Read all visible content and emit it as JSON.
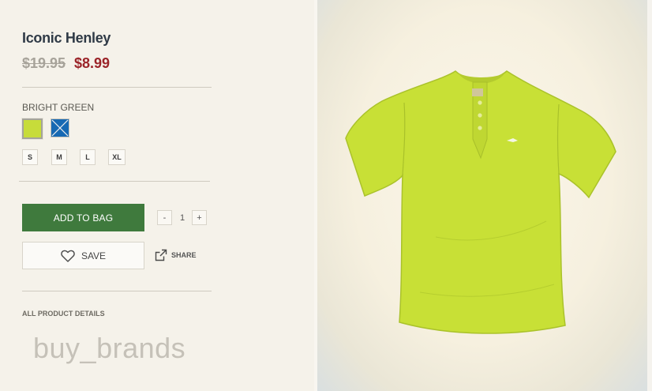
{
  "product": {
    "name": "Iconic Henley",
    "old_price": "$19.95",
    "price": "$8.99"
  },
  "color": {
    "selected_label": "BRIGHT GREEN",
    "swatches": [
      {
        "name": "bright green",
        "hex": "#c7dc3a"
      },
      {
        "name": "blue",
        "hex": "#1769b3"
      }
    ]
  },
  "sizes": [
    "S",
    "M",
    "L",
    "XL"
  ],
  "actions": {
    "add_to_bag": "ADD TO BAG",
    "qty_minus": "-",
    "qty_value": "1",
    "qty_plus": "+",
    "save": "SAVE",
    "share": "SHARE"
  },
  "details_link": "ALL PRODUCT DETAILS",
  "watermark": "buy_brands",
  "icons": {
    "save": "heart-icon",
    "share": "share-icon",
    "unavailable": "cross-icon"
  },
  "colors": {
    "add_to_bag_bg": "#3f7a3d",
    "sale_price": "#9b2429",
    "shirt": "#c8e036"
  }
}
